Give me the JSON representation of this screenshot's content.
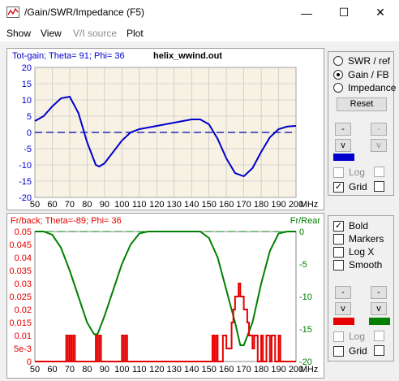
{
  "window": {
    "title": "/Gain/SWR/Impedance (F5)",
    "minimize_glyph": "—",
    "maximize_glyph": "☐",
    "close_glyph": "✕"
  },
  "menu": [
    "Show",
    "View",
    "V/I source",
    "Plot"
  ],
  "top_panel": {
    "header_left": "Tot-gain; Theta= 91; Phi= 36",
    "header_file": "helix_wwind.out",
    "radio": [
      "SWR / ref",
      "Gain / FB",
      "Impedance"
    ],
    "radio_selected": 1,
    "reset_label": "Reset",
    "up_label": "-",
    "down_label": "v",
    "log_label": "Log",
    "grid_label": "Grid",
    "log_checked": false,
    "grid_checked": true,
    "colors": {
      "trace": "#0000cc",
      "swatch": "#0000cc"
    }
  },
  "bottom_panel": {
    "header_left": "Fr/back; Theta=-89; Phi= 36",
    "header_right": "Fr/Rear",
    "checks": [
      {
        "label": "Bold",
        "checked": true
      },
      {
        "label": "Markers",
        "checked": false
      },
      {
        "label": "Log X",
        "checked": false
      },
      {
        "label": "Smooth",
        "checked": false
      }
    ],
    "up_label": "-",
    "down_label": "v",
    "log_label": "Log",
    "grid_label": "Grid",
    "log_checked": false,
    "grid_checked": false,
    "colors": {
      "left": "#e60000",
      "right": "#008000"
    }
  },
  "chart_data": [
    {
      "type": "line",
      "title": "Tot-gain; Theta= 91; Phi= 36",
      "xlabel": "MHz",
      "ylabel": "",
      "xlim": [
        50,
        200
      ],
      "ylim": [
        -20,
        20
      ],
      "x_ticks": [
        50,
        60,
        70,
        80,
        90,
        100,
        110,
        120,
        130,
        140,
        150,
        160,
        170,
        180,
        190,
        200
      ],
      "y_ticks": [
        -20,
        -15,
        -10,
        -5,
        0,
        5,
        10,
        15,
        20
      ],
      "grid": true,
      "reference_line": 0,
      "series": [
        {
          "color": "#0000cc",
          "x": [
            50,
            55,
            60,
            65,
            70,
            75,
            80,
            85,
            87,
            90,
            95,
            100,
            105,
            110,
            120,
            130,
            140,
            145,
            150,
            155,
            160,
            165,
            170,
            175,
            180,
            185,
            190,
            195,
            200
          ],
          "y": [
            3.5,
            5,
            8,
            10.5,
            11,
            6,
            -3,
            -10,
            -10.5,
            -9.5,
            -6,
            -2.5,
            0,
            1,
            2,
            3,
            4,
            4,
            2.5,
            -2,
            -8,
            -12.5,
            -13.5,
            -11,
            -6,
            -1.5,
            1,
            1.8,
            2
          ]
        }
      ]
    },
    {
      "type": "line",
      "title": "Fr/back; Theta=-89; Phi= 36",
      "xlabel": "MHz",
      "xlim": [
        50,
        200
      ],
      "ylim_left": [
        0,
        0.05
      ],
      "ylim_right": [
        -20,
        0
      ],
      "x_ticks": [
        50,
        60,
        70,
        80,
        90,
        100,
        110,
        120,
        130,
        140,
        150,
        160,
        170,
        180,
        190,
        200
      ],
      "y_ticks_left": [
        "0",
        "5e-3",
        "0.01",
        "0.015",
        "0.02",
        "0.025",
        "0.03",
        "0.035",
        "0.04",
        "0.045",
        "0.05"
      ],
      "y_ticks_right": [
        "0",
        "-5",
        "-10",
        "-15",
        "-20"
      ],
      "right_axis_label": "Fr/Rear",
      "grid": false,
      "reference_line_right": 0,
      "series": [
        {
          "color": "#008000",
          "axis": "right",
          "x": [
            50,
            55,
            60,
            65,
            70,
            75,
            80,
            84,
            86,
            90,
            95,
            100,
            105,
            110,
            115,
            120,
            125,
            130,
            140,
            145,
            150,
            155,
            160,
            165,
            168,
            170,
            175,
            180,
            185,
            190,
            195,
            200
          ],
          "y": [
            0,
            0,
            -0.5,
            -2.5,
            -6,
            -10,
            -14,
            -15.8,
            -15.8,
            -13,
            -9,
            -5,
            -2,
            -0.3,
            0,
            0,
            0,
            0,
            0,
            0,
            -1,
            -4,
            -9,
            -14,
            -17.5,
            -17.5,
            -14,
            -8,
            -3,
            -0.3,
            0,
            0
          ]
        },
        {
          "color": "#e60000",
          "axis": "left",
          "x": [
            50,
            68,
            68,
            69,
            69,
            70,
            70,
            71,
            71,
            72,
            72,
            73,
            73,
            74,
            74,
            85,
            85,
            86,
            86,
            87,
            87,
            88,
            88,
            89,
            89,
            100,
            100,
            101,
            101,
            102,
            102,
            103,
            103,
            152,
            152,
            153,
            153,
            154,
            154,
            155,
            155,
            158,
            158,
            160,
            160,
            163,
            163,
            164,
            164,
            165,
            165,
            167,
            167,
            168,
            168,
            170,
            170,
            172,
            172,
            173,
            173,
            175,
            175,
            176,
            176,
            178,
            178,
            180,
            180,
            181,
            181,
            183,
            183,
            185,
            185,
            186,
            186,
            188,
            188,
            190,
            190,
            191,
            191,
            193,
            193,
            200
          ],
          "y": [
            0,
            0,
            0.01,
            0.01,
            0,
            0,
            0.01,
            0.01,
            0,
            0,
            0.01,
            0.01,
            0,
            0,
            0,
            0,
            0.01,
            0.01,
            0,
            0,
            0.01,
            0.01,
            0,
            0,
            0,
            0,
            0.01,
            0.01,
            0,
            0,
            0.01,
            0.01,
            0,
            0,
            0.01,
            0.01,
            0,
            0,
            0.01,
            0.01,
            0,
            0,
            0.01,
            0.01,
            0.005,
            0.005,
            0.015,
            0.015,
            0.02,
            0.02,
            0.025,
            0.025,
            0.03,
            0.03,
            0.025,
            0.025,
            0.02,
            0.02,
            0.015,
            0.015,
            0.01,
            0.01,
            0.005,
            0.005,
            0.01,
            0.01,
            0,
            0,
            0.01,
            0.01,
            0,
            0,
            0.01,
            0.01,
            0,
            0,
            0.01,
            0.01,
            0,
            0,
            0.01,
            0.01,
            0,
            0,
            0,
            0
          ]
        }
      ]
    }
  ]
}
